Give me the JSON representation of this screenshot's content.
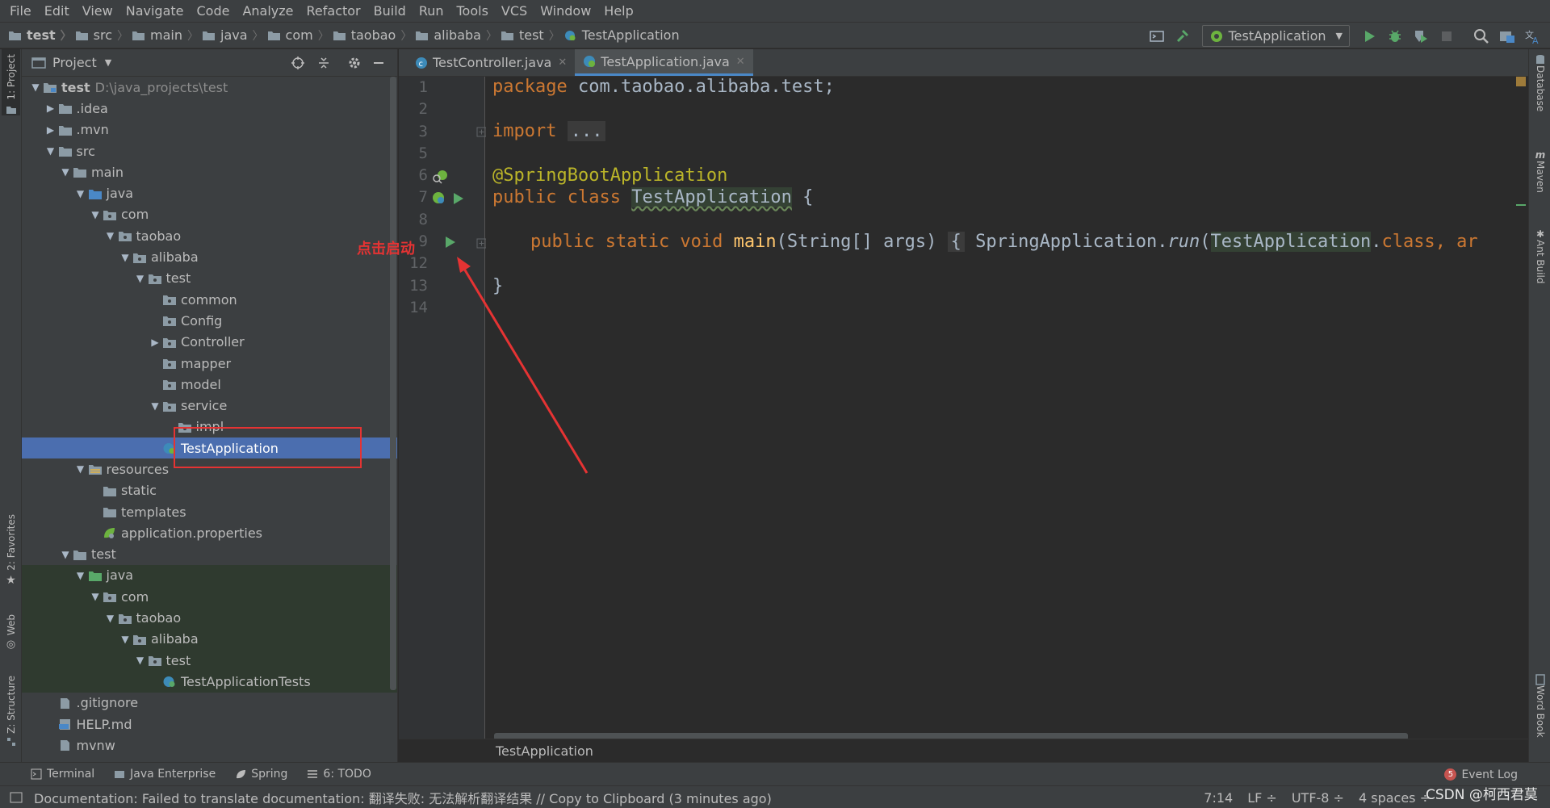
{
  "menu": [
    "File",
    "Edit",
    "View",
    "Navigate",
    "Code",
    "Analyze",
    "Refactor",
    "Build",
    "Run",
    "Tools",
    "VCS",
    "Window",
    "Help"
  ],
  "navbar": {
    "crumbs": [
      "test",
      "src",
      "main",
      "java",
      "com",
      "taobao",
      "alibaba",
      "test",
      "TestApplication"
    ],
    "run_config": "TestApplication"
  },
  "left_tabs": [
    "1: Project",
    "2: Favorites",
    "Web",
    "Z: Structure"
  ],
  "right_tabs": [
    "Database",
    "Maven",
    "Ant Build",
    "Word Book"
  ],
  "project": {
    "title": "Project",
    "tree": [
      {
        "label": "test",
        "path": "D:\\java_projects\\test",
        "depth": 0,
        "arrow": "down",
        "icon": "module-folder",
        "bold": true
      },
      {
        "label": ".idea",
        "depth": 1,
        "arrow": "right",
        "icon": "folder"
      },
      {
        "label": ".mvn",
        "depth": 1,
        "arrow": "right",
        "icon": "folder"
      },
      {
        "label": "src",
        "depth": 1,
        "arrow": "down",
        "icon": "folder"
      },
      {
        "label": "main",
        "depth": 2,
        "arrow": "down",
        "icon": "folder"
      },
      {
        "label": "java",
        "depth": 3,
        "arrow": "down",
        "icon": "source-folder"
      },
      {
        "label": "com",
        "depth": 4,
        "arrow": "down",
        "icon": "package"
      },
      {
        "label": "taobao",
        "depth": 5,
        "arrow": "down",
        "icon": "package"
      },
      {
        "label": "alibaba",
        "depth": 6,
        "arrow": "down",
        "icon": "package"
      },
      {
        "label": "test",
        "depth": 7,
        "arrow": "down",
        "icon": "package"
      },
      {
        "label": "common",
        "depth": 8,
        "arrow": "",
        "icon": "package"
      },
      {
        "label": "Config",
        "depth": 8,
        "arrow": "",
        "icon": "package"
      },
      {
        "label": "Controller",
        "depth": 8,
        "arrow": "right",
        "icon": "package"
      },
      {
        "label": "mapper",
        "depth": 8,
        "arrow": "",
        "icon": "package"
      },
      {
        "label": "model",
        "depth": 8,
        "arrow": "",
        "icon": "package"
      },
      {
        "label": "service",
        "depth": 8,
        "arrow": "down",
        "icon": "package"
      },
      {
        "label": "impl",
        "depth": 9,
        "arrow": "",
        "icon": "package"
      },
      {
        "label": "TestApplication",
        "depth": 8,
        "arrow": "",
        "icon": "spring-class",
        "selected": true
      },
      {
        "label": "resources",
        "depth": 3,
        "arrow": "down",
        "icon": "resources-folder"
      },
      {
        "label": "static",
        "depth": 4,
        "arrow": "",
        "icon": "folder"
      },
      {
        "label": "templates",
        "depth": 4,
        "arrow": "",
        "icon": "folder"
      },
      {
        "label": "application.properties",
        "depth": 4,
        "arrow": "",
        "icon": "spring-properties"
      },
      {
        "label": "test",
        "depth": 2,
        "arrow": "down",
        "icon": "folder"
      },
      {
        "label": "java",
        "depth": 3,
        "arrow": "down",
        "icon": "test-folder",
        "testsrc": true
      },
      {
        "label": "com",
        "depth": 4,
        "arrow": "down",
        "icon": "package",
        "testsrc": true
      },
      {
        "label": "taobao",
        "depth": 5,
        "arrow": "down",
        "icon": "package",
        "testsrc": true
      },
      {
        "label": "alibaba",
        "depth": 6,
        "arrow": "down",
        "icon": "package",
        "testsrc": true
      },
      {
        "label": "test",
        "depth": 7,
        "arrow": "down",
        "icon": "package",
        "testsrc": true
      },
      {
        "label": "TestApplicationTests",
        "depth": 8,
        "arrow": "",
        "icon": "class",
        "testsrc": true
      },
      {
        "label": ".gitignore",
        "depth": 1,
        "arrow": "",
        "icon": "file"
      },
      {
        "label": "HELP.md",
        "depth": 1,
        "arrow": "",
        "icon": "md-file"
      },
      {
        "label": "mvnw",
        "depth": 1,
        "arrow": "",
        "icon": "file"
      }
    ]
  },
  "editor": {
    "tabs": [
      {
        "label": "TestController.java",
        "active": false
      },
      {
        "label": "TestApplication.java",
        "active": true
      }
    ],
    "line_numbers": [
      "1",
      "2",
      "3",
      "5",
      "6",
      "7",
      "8",
      "9",
      "12",
      "13",
      "14"
    ],
    "code": {
      "l1_kw": "package",
      "l1_rest": " com.taobao.alibaba.test;",
      "l3_kw": "import",
      "l3_fold": "...",
      "l6_an": "@SpringBootApplication",
      "l7_kw": "public class",
      "l7_cls": "TestApplication",
      "l7_rest": " {",
      "l9_kw": "public static void",
      "l9_fn": "main",
      "l9_args": "(String[] args)",
      "l9_fold": "{",
      "l9_body1": "SpringApplication.",
      "l9_run": "run",
      "l9_paren": "(",
      "l9_cls": "TestApplication",
      "l9_dot": ".",
      "l9_classkw": "class",
      "l9_tail": ", ar",
      "l13": "}"
    },
    "bottom_crumb": "TestApplication"
  },
  "bottom_tabs": [
    "Terminal",
    "Java Enterprise",
    "Spring",
    "6: TODO"
  ],
  "event_log": {
    "count": "5",
    "label": "Event Log"
  },
  "status": {
    "message": "Documentation: Failed to translate documentation: 翻译失败: 无法解析翻译结果 // Copy to Clipboard (3 minutes ago)",
    "position": "7:14",
    "line_sep": "LF ÷",
    "encoding": "UTF-8 ÷",
    "indent": "4 spaces ÷"
  },
  "watermark": "CSDN @柯西君莫",
  "annotation": {
    "text": "点击启动"
  }
}
